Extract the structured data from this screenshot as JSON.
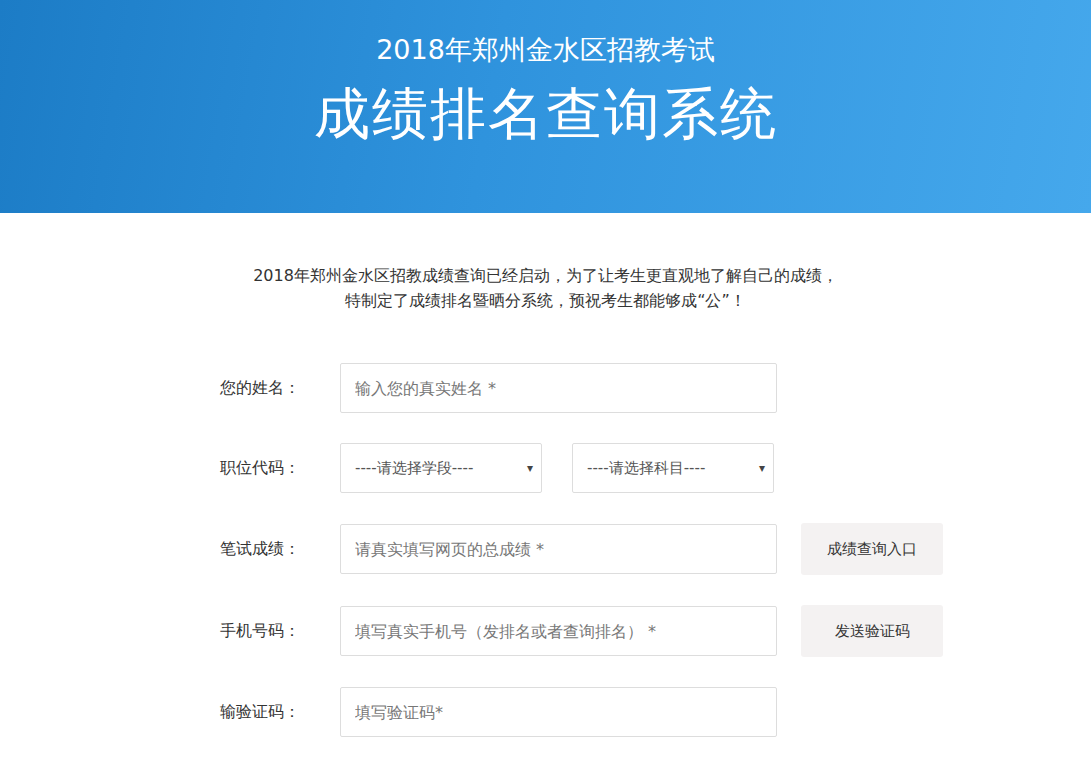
{
  "header": {
    "subtitle": "2018年郑州金水区招教考试",
    "title": "成绩排名查询系统"
  },
  "intro": [
    "2018年郑州金水区招教成绩查询已经启动，为了让考生更直观地了解自己的成绩，",
    "特制定了成绩排名暨晒分系统，预祝考生都能够成“公”！"
  ],
  "fields": [
    {
      "label": "您的姓名：",
      "kind": "input",
      "placeholder": "输入您的真实姓名 *",
      "button": "",
      "selects": []
    },
    {
      "label": "职位代码：",
      "kind": "selects",
      "placeholder": "",
      "button": "",
      "selects": [
        {
          "placeholder": "----请选择学段----",
          "arrow": "▾"
        },
        {
          "placeholder": "----请选择科目----",
          "arrow": "▾"
        }
      ]
    },
    {
      "label": "笔试成绩：",
      "kind": "input",
      "placeholder": "请真实填写网页的总成绩 *",
      "button": "成绩查询入口",
      "selects": []
    },
    {
      "label": "手机号码：",
      "kind": "input",
      "placeholder": "填写真实手机号（发排名或者查询排名） *",
      "button": "发送验证码",
      "selects": []
    },
    {
      "label": "输验证码：",
      "kind": "input",
      "placeholder": "填写验证码*",
      "button": "",
      "selects": []
    }
  ]
}
